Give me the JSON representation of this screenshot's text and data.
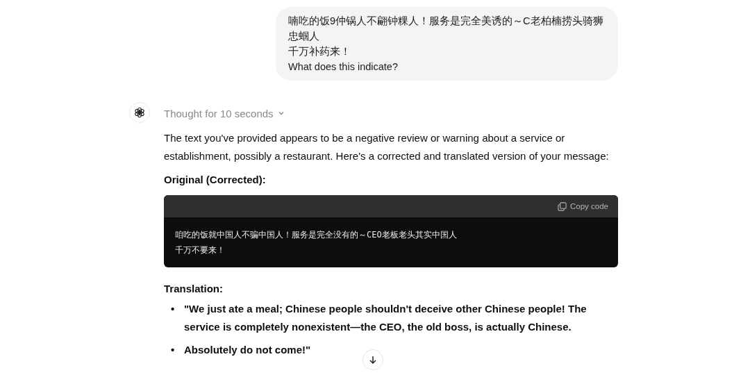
{
  "user_message": {
    "lines": [
      "喃吃的饭9仲锅人不翩钟粿人！服务是完全美诱的～C老柏楠捞头骑狮忠蝈人",
      "千万补药来！",
      "What does this indicate?"
    ]
  },
  "assistant": {
    "thought": {
      "label": "Thought for 10 seconds",
      "expanded": false
    },
    "intro": "The text you've provided appears to be a negative review or warning about a service or establishment, possibly a restaurant. Here's a corrected and translated version of your message:",
    "heading_original": "Original (Corrected):",
    "code_block": {
      "copy_label": "Copy code",
      "lines": [
        "咱吃的饭就中国人不骗中国人！服务是完全没有的～CEO老板老头其实中国人",
        "千万不要来！"
      ]
    },
    "heading_translation": "Translation:",
    "bullets": [
      {
        "marker": "•",
        "text": "\"We just ate a meal; Chinese people shouldn't deceive other Chinese people! The service is completely nonexistent—the CEO, the old boss, is actually Chinese."
      },
      {
        "marker": "•",
        "text": "Absolutely do not come!\""
      }
    ]
  }
}
